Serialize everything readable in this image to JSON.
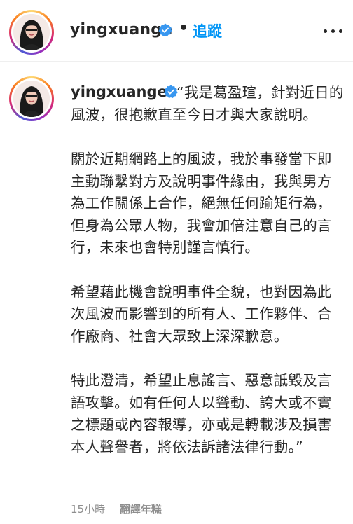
{
  "header": {
    "username": "yingxuange",
    "separator": "•",
    "follow_label": "追蹤"
  },
  "post": {
    "username": "yingxuange",
    "paragraphs": [
      "“我是葛盈瑄，針對近日的風波，很抱歉直至今日才與大家說明。",
      "關於近期網路上的風波，我於事發當下即主動聯繫對方及說明事件緣由，我與男方為工作關係上合作，絕無任何踰矩行為，但身為公眾人物，我會加倍注意自己的言行，未來也會特別謹言慎行。",
      "希望藉此機會說明事件全貌，也對因為此次風波而影響到的所有人、工作夥伴、合作廠商、社會大眾致上深深歉意。",
      "特此澄清，希望止息謠言、惡意詆毀及言語攻擊。如有任何人以聳動、誇大或不實之標題或內容報導，亦或是轉載涉及損害本人聲譽者，將依法訴諸法律行動。”"
    ],
    "time": "15小時",
    "translate_label": "翻譯年糕"
  },
  "icons": {
    "verified": "verified-badge-icon",
    "more": "more-options-icon"
  },
  "colors": {
    "link_blue": "#0095f6",
    "verified_blue": "#3897f0",
    "text": "#262626",
    "muted": "#8e8e8e"
  }
}
